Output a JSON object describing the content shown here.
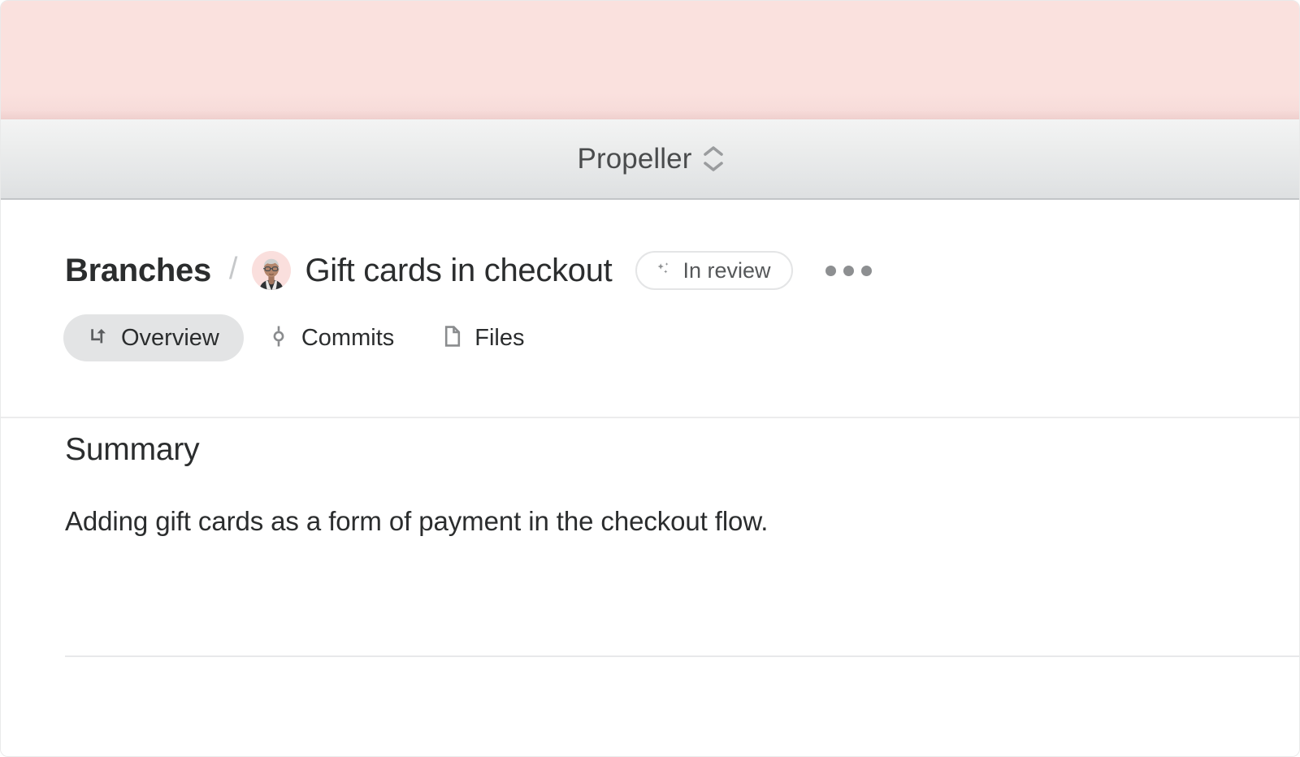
{
  "window": {
    "accent_color": "#fae1de",
    "toolbar_bg_top": "#f3f4f4",
    "toolbar_bg_bottom": "#dee0e1"
  },
  "toolbar": {
    "workspace_name": "Propeller",
    "switcher_icon": "chevron-up-down-icon"
  },
  "header": {
    "breadcrumb_root": "Branches",
    "breadcrumb_separator": "/",
    "avatar_alt": "user-avatar",
    "avatar_bg": "#fadfdd",
    "title": "Gift cards in checkout",
    "status": {
      "label": "In review",
      "icon": "sparkle-icon",
      "border_color": "#e4e5e6",
      "text_color": "#56585a"
    },
    "more_menu": {
      "label": "More actions",
      "icon": "ellipsis-icon"
    }
  },
  "tabs": [
    {
      "label": "Overview",
      "icon": "git-branch-icon",
      "active": true
    },
    {
      "label": "Commits",
      "icon": "git-commit-icon",
      "active": false
    },
    {
      "label": "Files",
      "icon": "file-icon",
      "active": false
    }
  ],
  "main": {
    "summary_heading": "Summary",
    "summary_text": "Adding gift cards as a form of payment in the checkout flow."
  }
}
